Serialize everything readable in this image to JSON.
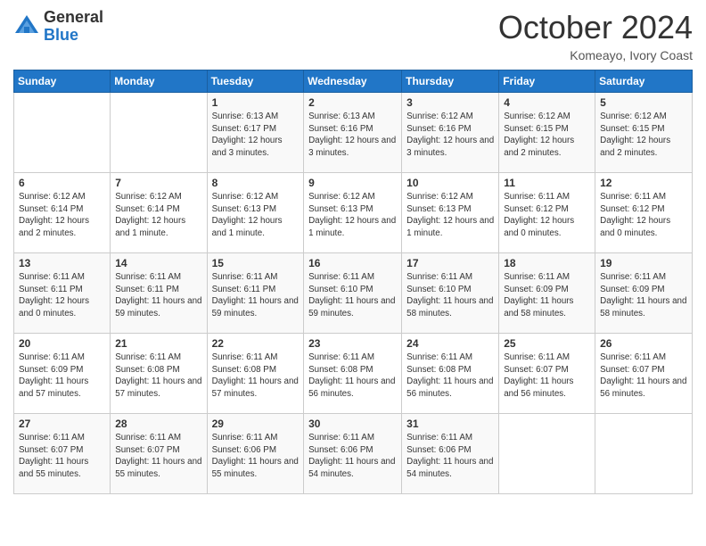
{
  "logo": {
    "general": "General",
    "blue": "Blue"
  },
  "header": {
    "month": "October 2024",
    "location": "Komeayo, Ivory Coast"
  },
  "weekdays": [
    "Sunday",
    "Monday",
    "Tuesday",
    "Wednesday",
    "Thursday",
    "Friday",
    "Saturday"
  ],
  "weeks": [
    [
      {
        "day": "",
        "info": ""
      },
      {
        "day": "",
        "info": ""
      },
      {
        "day": "1",
        "info": "Sunrise: 6:13 AM\nSunset: 6:17 PM\nDaylight: 12 hours and 3 minutes."
      },
      {
        "day": "2",
        "info": "Sunrise: 6:13 AM\nSunset: 6:16 PM\nDaylight: 12 hours and 3 minutes."
      },
      {
        "day": "3",
        "info": "Sunrise: 6:12 AM\nSunset: 6:16 PM\nDaylight: 12 hours and 3 minutes."
      },
      {
        "day": "4",
        "info": "Sunrise: 6:12 AM\nSunset: 6:15 PM\nDaylight: 12 hours and 2 minutes."
      },
      {
        "day": "5",
        "info": "Sunrise: 6:12 AM\nSunset: 6:15 PM\nDaylight: 12 hours and 2 minutes."
      }
    ],
    [
      {
        "day": "6",
        "info": "Sunrise: 6:12 AM\nSunset: 6:14 PM\nDaylight: 12 hours and 2 minutes."
      },
      {
        "day": "7",
        "info": "Sunrise: 6:12 AM\nSunset: 6:14 PM\nDaylight: 12 hours and 1 minute."
      },
      {
        "day": "8",
        "info": "Sunrise: 6:12 AM\nSunset: 6:13 PM\nDaylight: 12 hours and 1 minute."
      },
      {
        "day": "9",
        "info": "Sunrise: 6:12 AM\nSunset: 6:13 PM\nDaylight: 12 hours and 1 minute."
      },
      {
        "day": "10",
        "info": "Sunrise: 6:12 AM\nSunset: 6:13 PM\nDaylight: 12 hours and 1 minute."
      },
      {
        "day": "11",
        "info": "Sunrise: 6:11 AM\nSunset: 6:12 PM\nDaylight: 12 hours and 0 minutes."
      },
      {
        "day": "12",
        "info": "Sunrise: 6:11 AM\nSunset: 6:12 PM\nDaylight: 12 hours and 0 minutes."
      }
    ],
    [
      {
        "day": "13",
        "info": "Sunrise: 6:11 AM\nSunset: 6:11 PM\nDaylight: 12 hours and 0 minutes."
      },
      {
        "day": "14",
        "info": "Sunrise: 6:11 AM\nSunset: 6:11 PM\nDaylight: 11 hours and 59 minutes."
      },
      {
        "day": "15",
        "info": "Sunrise: 6:11 AM\nSunset: 6:11 PM\nDaylight: 11 hours and 59 minutes."
      },
      {
        "day": "16",
        "info": "Sunrise: 6:11 AM\nSunset: 6:10 PM\nDaylight: 11 hours and 59 minutes."
      },
      {
        "day": "17",
        "info": "Sunrise: 6:11 AM\nSunset: 6:10 PM\nDaylight: 11 hours and 58 minutes."
      },
      {
        "day": "18",
        "info": "Sunrise: 6:11 AM\nSunset: 6:09 PM\nDaylight: 11 hours and 58 minutes."
      },
      {
        "day": "19",
        "info": "Sunrise: 6:11 AM\nSunset: 6:09 PM\nDaylight: 11 hours and 58 minutes."
      }
    ],
    [
      {
        "day": "20",
        "info": "Sunrise: 6:11 AM\nSunset: 6:09 PM\nDaylight: 11 hours and 57 minutes."
      },
      {
        "day": "21",
        "info": "Sunrise: 6:11 AM\nSunset: 6:08 PM\nDaylight: 11 hours and 57 minutes."
      },
      {
        "day": "22",
        "info": "Sunrise: 6:11 AM\nSunset: 6:08 PM\nDaylight: 11 hours and 57 minutes."
      },
      {
        "day": "23",
        "info": "Sunrise: 6:11 AM\nSunset: 6:08 PM\nDaylight: 11 hours and 56 minutes."
      },
      {
        "day": "24",
        "info": "Sunrise: 6:11 AM\nSunset: 6:08 PM\nDaylight: 11 hours and 56 minutes."
      },
      {
        "day": "25",
        "info": "Sunrise: 6:11 AM\nSunset: 6:07 PM\nDaylight: 11 hours and 56 minutes."
      },
      {
        "day": "26",
        "info": "Sunrise: 6:11 AM\nSunset: 6:07 PM\nDaylight: 11 hours and 56 minutes."
      }
    ],
    [
      {
        "day": "27",
        "info": "Sunrise: 6:11 AM\nSunset: 6:07 PM\nDaylight: 11 hours and 55 minutes."
      },
      {
        "day": "28",
        "info": "Sunrise: 6:11 AM\nSunset: 6:07 PM\nDaylight: 11 hours and 55 minutes."
      },
      {
        "day": "29",
        "info": "Sunrise: 6:11 AM\nSunset: 6:06 PM\nDaylight: 11 hours and 55 minutes."
      },
      {
        "day": "30",
        "info": "Sunrise: 6:11 AM\nSunset: 6:06 PM\nDaylight: 11 hours and 54 minutes."
      },
      {
        "day": "31",
        "info": "Sunrise: 6:11 AM\nSunset: 6:06 PM\nDaylight: 11 hours and 54 minutes."
      },
      {
        "day": "",
        "info": ""
      },
      {
        "day": "",
        "info": ""
      }
    ]
  ]
}
